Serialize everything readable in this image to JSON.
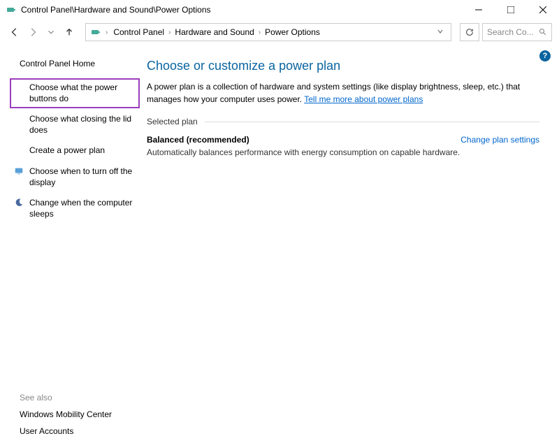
{
  "window": {
    "title": "Control Panel\\Hardware and Sound\\Power Options"
  },
  "breadcrumb": {
    "seg1": "Control Panel",
    "seg2": "Hardware and Sound",
    "seg3": "Power Options"
  },
  "search": {
    "placeholder": "Search Co..."
  },
  "sidebar": {
    "home": "Control Panel Home",
    "links": {
      "power_buttons": "Choose what the power buttons do",
      "closing_lid": "Choose what closing the lid does",
      "create_plan": "Create a power plan",
      "turn_off_display": "Choose when to turn off the display",
      "computer_sleeps": "Change when the computer sleeps"
    },
    "see_also": {
      "title": "See also",
      "mobility": "Windows Mobility Center",
      "accounts": "User Accounts"
    }
  },
  "main": {
    "title": "Choose or customize a power plan",
    "desc_part1": "A power plan is a collection of hardware and system settings (like display brightness, sleep, etc.) that manages how your computer uses power. ",
    "desc_link": "Tell me more about power plans",
    "section": "Selected plan",
    "plan_name": "Balanced (recommended)",
    "plan_action": "Change plan settings",
    "plan_desc": "Automatically balances performance with energy consumption on capable hardware."
  },
  "help": "?"
}
